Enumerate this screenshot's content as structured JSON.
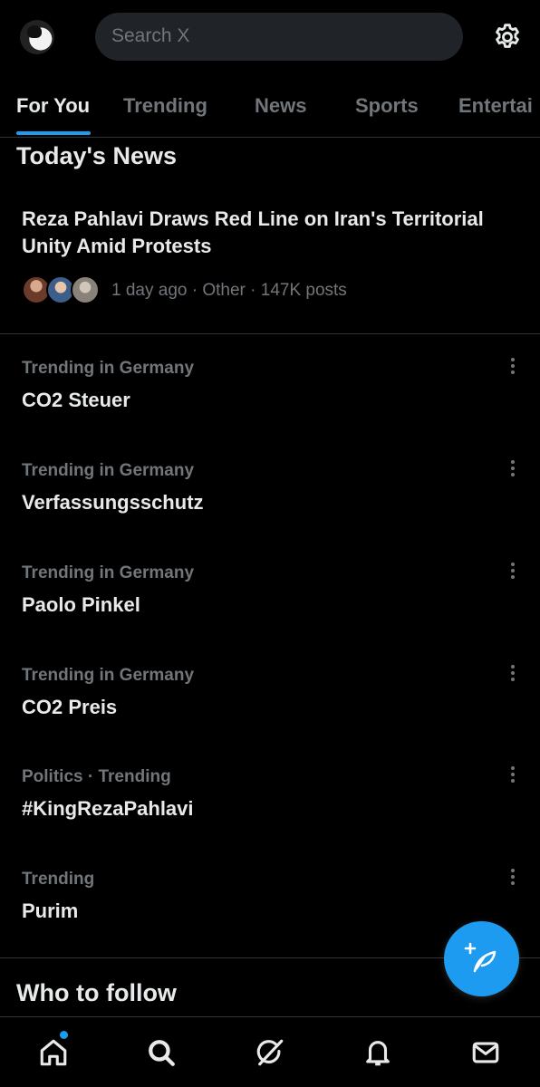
{
  "header": {
    "search_placeholder": "Search X"
  },
  "tabs": [
    {
      "label": "For You",
      "active": true
    },
    {
      "label": "Trending",
      "active": false
    },
    {
      "label": "News",
      "active": false
    },
    {
      "label": "Sports",
      "active": false
    },
    {
      "label": "Entertai",
      "active": false
    }
  ],
  "todays_news": {
    "title": "Today's News",
    "headline": "Reza Pahlavi Draws Red Line on Iran's Territorial Unity Amid Protests",
    "meta": "1 day ago · Other · 147K posts"
  },
  "trends": [
    {
      "context": "Trending in Germany",
      "name": "CO2 Steuer"
    },
    {
      "context": "Trending in Germany",
      "name": "Verfassungsschutz"
    },
    {
      "context": "Trending in Germany",
      "name": "Paolo Pinkel"
    },
    {
      "context": "Trending in Germany",
      "name": "CO2 Preis"
    },
    {
      "context": "Politics · Trending",
      "name": "#KingRezaPahlavi"
    },
    {
      "context": "Trending",
      "name": "Purim"
    }
  ],
  "who_to_follow": {
    "title": "Who to follow"
  },
  "colors": {
    "accent": "#1d9bf0",
    "background": "#000000",
    "text_primary": "#e7e9ea",
    "text_secondary": "#71767b"
  },
  "icons": {
    "settings": "gear-icon",
    "compose": "compose-post-icon",
    "nav": [
      "home-icon",
      "search-icon",
      "grok-icon",
      "notifications-icon",
      "messages-icon"
    ]
  }
}
